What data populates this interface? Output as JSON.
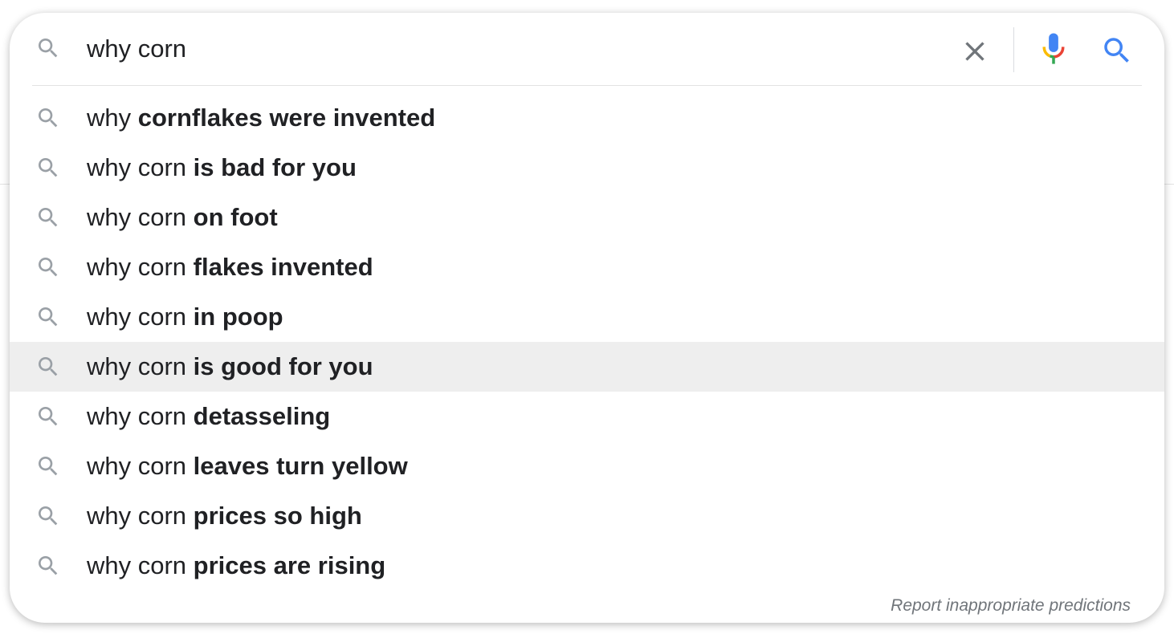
{
  "search": {
    "query": "why corn",
    "clear_icon": "close-icon",
    "voice_icon": "microphone-icon",
    "submit_icon": "search-icon"
  },
  "suggestions": [
    {
      "prefix": "why ",
      "completion": "cornflakes were invented",
      "highlighted": false
    },
    {
      "prefix": "why corn ",
      "completion": "is bad for you",
      "highlighted": false
    },
    {
      "prefix": "why corn ",
      "completion": "on foot",
      "highlighted": false
    },
    {
      "prefix": "why corn ",
      "completion": "flakes invented",
      "highlighted": false
    },
    {
      "prefix": "why corn ",
      "completion": "in poop",
      "highlighted": false
    },
    {
      "prefix": "why corn ",
      "completion": "is good for you",
      "highlighted": true
    },
    {
      "prefix": "why corn ",
      "completion": "detasseling",
      "highlighted": false
    },
    {
      "prefix": "why corn ",
      "completion": "leaves turn yellow",
      "highlighted": false
    },
    {
      "prefix": "why corn ",
      "completion": "prices so high",
      "highlighted": false
    },
    {
      "prefix": "why corn ",
      "completion": "prices are rising",
      "highlighted": false
    }
  ],
  "footer": {
    "report_label": "Report inappropriate predictions"
  },
  "colors": {
    "highlight_bg": "#eeeeee",
    "text": "#202124",
    "icon_gray": "#9aa0a6",
    "google_blue": "#4285f4",
    "google_red": "#ea4335",
    "google_yellow": "#fbbc05",
    "google_green": "#34a853"
  }
}
